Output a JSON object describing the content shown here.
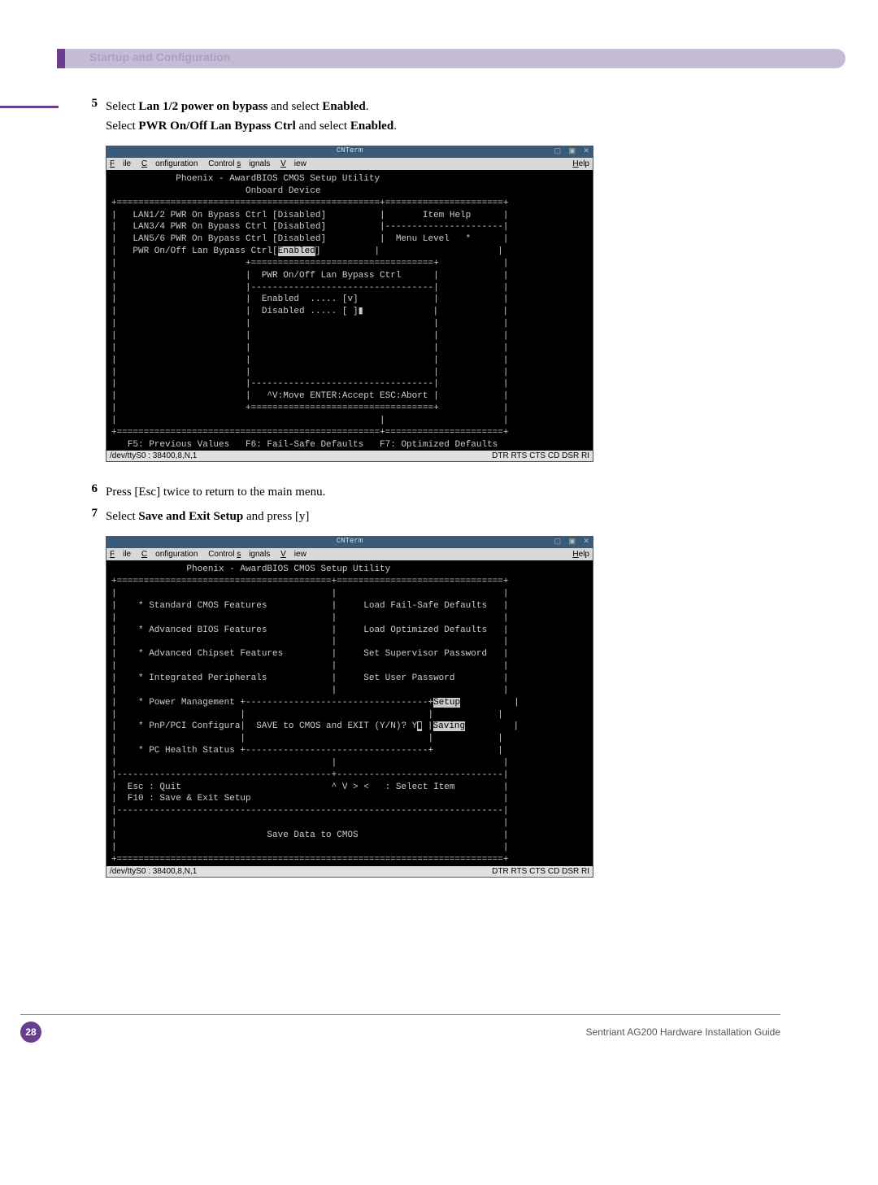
{
  "header": {
    "section_title": "Startup and Configuration"
  },
  "steps": {
    "s5": {
      "num": "5",
      "p1_a": "Select ",
      "p1_b": "Lan 1/2 power on bypass",
      "p1_c": " and select ",
      "p1_d": "Enabled",
      "p1_e": ".",
      "p2_a": "Select ",
      "p2_b": "PWR On/Off Lan Bypass Ctrl",
      "p2_c": " and select ",
      "p2_d": "Enabled",
      "p2_e": "."
    },
    "s6": {
      "num": "6",
      "txt": "Press [Esc] twice to return to the main menu."
    },
    "s7": {
      "num": "7",
      "txt_a": "Select ",
      "txt_b": "Save and Exit Setup",
      "txt_c": " and press [y]"
    }
  },
  "term_common": {
    "wintitle": "CNTerm",
    "winbtns": "▢ ▣ ✕",
    "menu_file": "File",
    "menu_config": "Configuration",
    "menu_signals": "Control signals",
    "menu_view": "View",
    "menu_help": "Help",
    "status_left": "/dev/ttyS0 : 38400,8,N,1",
    "status_right": "DTR RTS CTS CD DSR RI"
  },
  "term1": {
    "l01": "            Phoenix - AwardBIOS CMOS Setup Utility",
    "l02": "                         Onboard Device",
    "l03": "+=================================================+======================+",
    "l04": "|   LAN1/2 PWR On Bypass Ctrl [Disabled]          |       Item Help      |",
    "l05": "|   LAN3/4 PWR On Bypass Ctrl [Disabled]          |----------------------|",
    "l06": "|   LAN5/6 PWR On Bypass Ctrl [Disabled]          |  Menu Level   *      |",
    "l07a": "|   PWR On/Off Lan Bypass Ctrl[",
    "l07b": "Enabled",
    "l07c": "]          |                      |",
    "l08": "|                        +==================================+            |",
    "l09": "|                        |  PWR On/Off Lan Bypass Ctrl      |            |",
    "l10": "|                        |----------------------------------|            |",
    "l11": "|                        |  Enabled  ..... [v]              |            |",
    "l12": "|                        |  Disabled ..... [ ]▮             |            |",
    "l13": "|                        |                                  |            |",
    "l14": "|                        |                                  |            |",
    "l15": "|                        |                                  |            |",
    "l16": "|                        |                                  |            |",
    "l17": "|                        |                                  |            |",
    "l18": "|                        |----------------------------------|            |",
    "l19": "|                        |   ^V:Move ENTER:Accept ESC:Abort |            |",
    "l20": "|                        +==================================+            |",
    "l21": "|                                                 |                      |",
    "l22": "+=================================================+======================+",
    "l23": "   F5: Previous Values   F6: Fail-Safe Defaults   F7: Optimized Defaults"
  },
  "term2": {
    "l01": "              Phoenix - AwardBIOS CMOS Setup Utility",
    "l02": "+========================================+===============================+",
    "l03": "|                                        |                               |",
    "l04": "|    * Standard CMOS Features            |     Load Fail-Safe Defaults   |",
    "l05": "|                                        |                               |",
    "l06": "|    * Advanced BIOS Features            |     Load Optimized Defaults   |",
    "l07": "|                                        |                               |",
    "l08": "|    * Advanced Chipset Features         |     Set Supervisor Password   |",
    "l09": "|                                        |                               |",
    "l10": "|    * Integrated Peripherals            |     Set User Password         |",
    "l11": "|                                        |                               |",
    "l12a": "|    * Power Management +----------------------------------+",
    "l12b": "Setup",
    "l12c": "          |",
    "l13": "|                       |                                  |            |",
    "l14a": "|    * PnP/PCI Configura|  SAVE to CMOS and EXIT (Y/N)? Y",
    "l14b": "▮",
    "l14c": " |",
    "l14d": "Saving",
    "l14e": "         |",
    "l15": "|                       |                                  |            |",
    "l16": "|    * PC Health Status +----------------------------------+            |",
    "l17": "|                                        |                               |",
    "l18": "|----------------------------------------+-------------------------------|",
    "l19": "|  Esc : Quit                            ^ V > <   : Select Item         |",
    "l20": "|  F10 : Save & Exit Setup                                               |",
    "l21": "|------------------------------------------------------------------------|",
    "l22": "|                                                                        |",
    "l23": "|                            Save Data to CMOS                           |",
    "l24": "|                                                                        |",
    "l25": "+========================================================================+"
  },
  "footer": {
    "page": "28",
    "title": "Sentriant AG200 Hardware Installation Guide"
  }
}
